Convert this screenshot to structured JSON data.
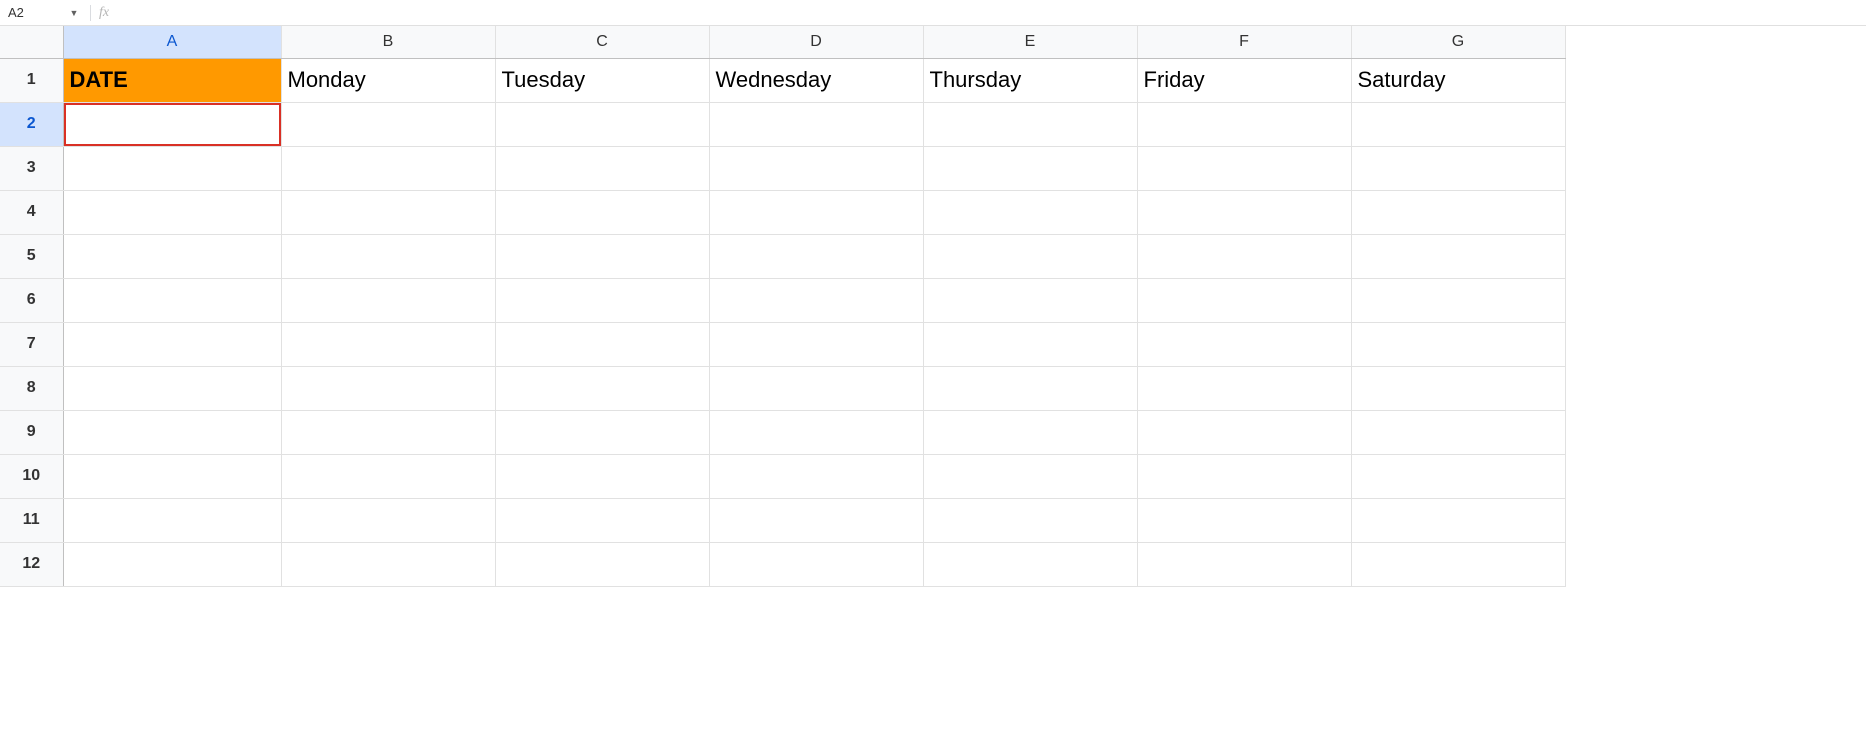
{
  "nameBox": "A2",
  "fxLabel": "fx",
  "formula": "",
  "columns": [
    "A",
    "B",
    "C",
    "D",
    "E",
    "F",
    "G"
  ],
  "selectedColumn": "A",
  "rows": [
    1,
    2,
    3,
    4,
    5,
    6,
    7,
    8,
    9,
    10,
    11,
    12
  ],
  "selectedRow": 2,
  "cells": {
    "A1": "DATE",
    "B1": "Monday",
    "C1": "Tuesday",
    "D1": "Wednesday",
    "E1": "Thursday",
    "F1": "Friday",
    "G1": "Saturday"
  },
  "selectedCell": "A2"
}
